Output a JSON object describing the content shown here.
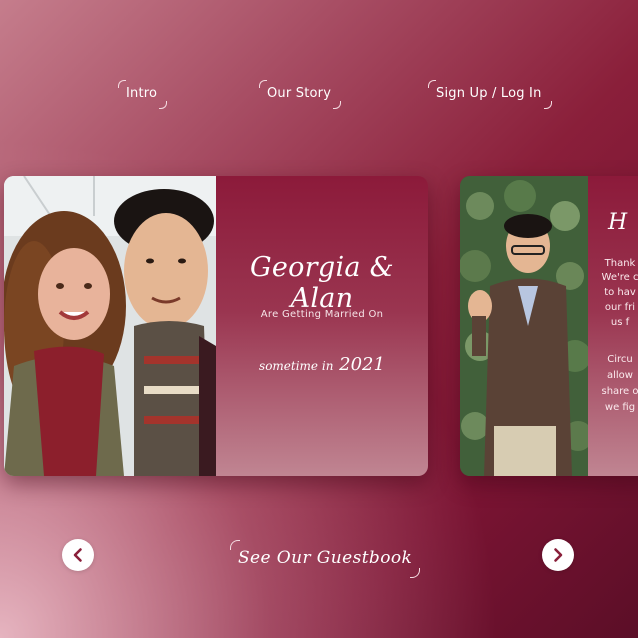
{
  "nav": {
    "items": [
      {
        "label": "Intro"
      },
      {
        "label": "Our Story"
      },
      {
        "label": "Sign Up / Log In"
      }
    ]
  },
  "hero_card": {
    "names": "Georgia & Alan",
    "subtitle": "Are Getting Married On",
    "date_prefix": "sometime in",
    "date_year": "2021",
    "photo": "couple-selfie-photo"
  },
  "second_card": {
    "heading_fragment": "H",
    "lines": [
      "Thank",
      "We're c",
      "to hav",
      "our fri",
      "us f",
      "",
      "Circu",
      "allow",
      "share o",
      "we fig"
    ],
    "photo": "groom-waving-photo"
  },
  "controls": {
    "prev_icon": "chevron-left-icon",
    "next_icon": "chevron-right-icon",
    "guestbook_label": "See Our Guestbook"
  },
  "colors": {
    "accent": "#8a1f3a",
    "button_bg": "#ffffff",
    "arrow_color": "#8a1f3a"
  }
}
